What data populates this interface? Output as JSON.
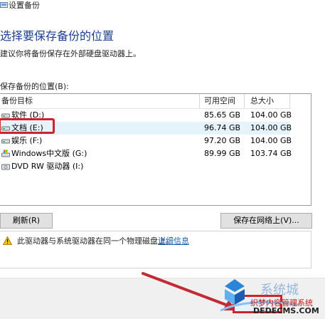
{
  "window": {
    "title": "设置备份"
  },
  "page": {
    "heading": "选择要保存备份的位置",
    "subtext": "建议你将备份保存在外部硬盘驱动器上。",
    "list_label": "保存备份的位置(B):"
  },
  "table": {
    "headers": [
      "备份目标",
      "可用空间",
      "总大小"
    ],
    "rows": [
      {
        "name": "软件 (D:)",
        "free": "85.65 GB",
        "total": "104.00 GB",
        "icon": "drive-icon",
        "selected": false
      },
      {
        "name": "文档 (E:)",
        "free": "96.74 GB",
        "total": "104.00 GB",
        "icon": "drive-icon",
        "selected": true
      },
      {
        "name": "娱乐 (F:)",
        "free": "97.20 GB",
        "total": "104.00 GB",
        "icon": "drive-icon",
        "selected": false
      },
      {
        "name": "Windows中文版 (G:)",
        "free": "89.99 GB",
        "total": "103.74 GB",
        "icon": "windows-drive-icon",
        "selected": false
      },
      {
        "name": "DVD RW 驱动器 (I:)",
        "free": "",
        "total": "",
        "icon": "dvd-drive-icon",
        "selected": false
      }
    ]
  },
  "buttons": {
    "refresh": "刷新(R)",
    "save_network": "保存在网络上(V)..."
  },
  "warning": {
    "text": "此驱动器与系统驱动器在同一个物理磁盘上。",
    "link": "详细信息"
  },
  "watermark": {
    "site": "系统城",
    "cms": "织梦内容管理系统",
    "domain": "DEDECMS.COM"
  },
  "colors": {
    "heading": "#1c3f8f",
    "selected_row": "#e5f3fb",
    "highlight_red": "#d1212f",
    "link": "#1a5fb4"
  }
}
